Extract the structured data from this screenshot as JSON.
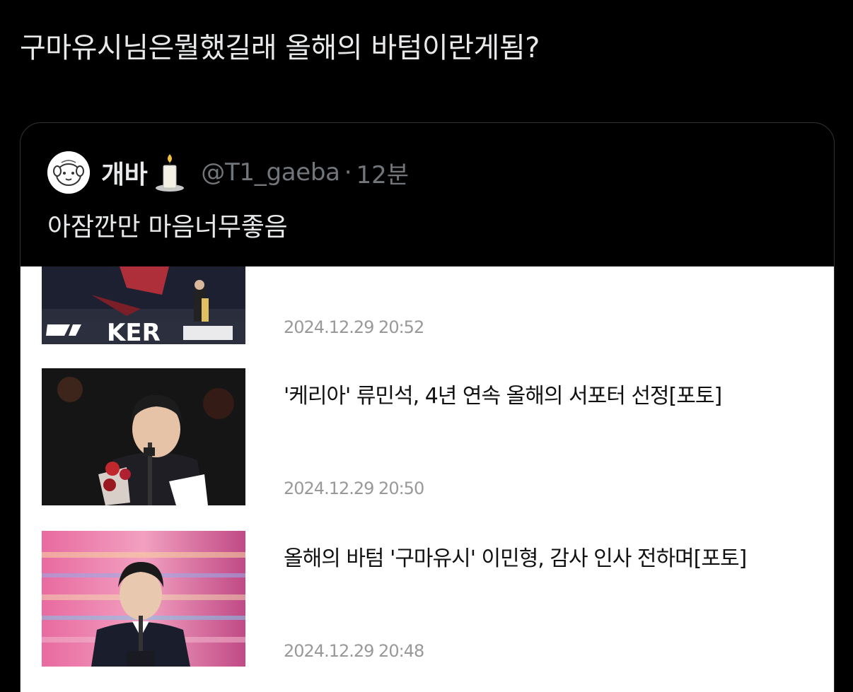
{
  "tweet": {
    "text": "구마유시님은뭘했길래 올해의 바텀이란게됨?"
  },
  "quote": {
    "display_name": "개바",
    "handle": "@T1_gaeba",
    "separator": "·",
    "time_ago": "12분",
    "text": "아잠깐만 마음너무좋음"
  },
  "news": {
    "items": [
      {
        "title": "",
        "date": "2024.12.29 20:52",
        "thumb_text": "KER"
      },
      {
        "title": "'케리아' 류민석, 4년 연속 올해의 서포터 선정[포토]",
        "date": "2024.12.29 20:50"
      },
      {
        "title": "올해의 바텀 '구마유시' 이민형, 감사 인사 전하며[포토]",
        "date": "2024.12.29 20:48"
      }
    ]
  },
  "colors": {
    "background": "#000000",
    "primary_text": "#e7e9ea",
    "secondary_text": "#71767b",
    "card_border": "#2f3336",
    "news_bg": "#ffffff",
    "news_title": "#111111",
    "news_date": "#999999"
  },
  "icons": {
    "avatar": "sheep-avatar-icon",
    "candle": "candle-icon"
  }
}
